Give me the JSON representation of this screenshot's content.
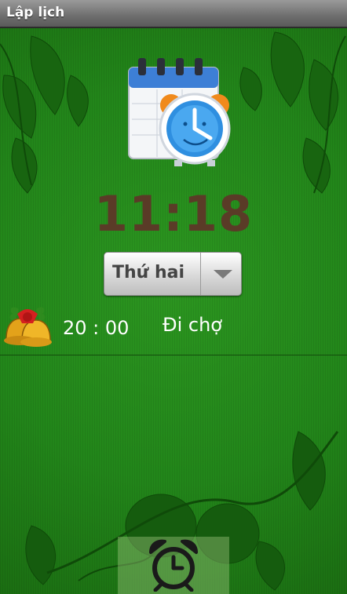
{
  "app": {
    "title": "Lập lịch"
  },
  "clock": {
    "time": "11:18"
  },
  "day_selector": {
    "selected": "Thứ hai"
  },
  "alarms": [
    {
      "time": "20 : 00",
      "label": "Đi chợ"
    }
  ],
  "colors": {
    "background": "#1f7a15",
    "clock_text": "#5a3b27",
    "titlebar": "#7a7a7a"
  },
  "icons": [
    "calendar-alarm-icon",
    "bell-icon",
    "dropdown-arrow-icon",
    "alarm-clock-icon"
  ]
}
